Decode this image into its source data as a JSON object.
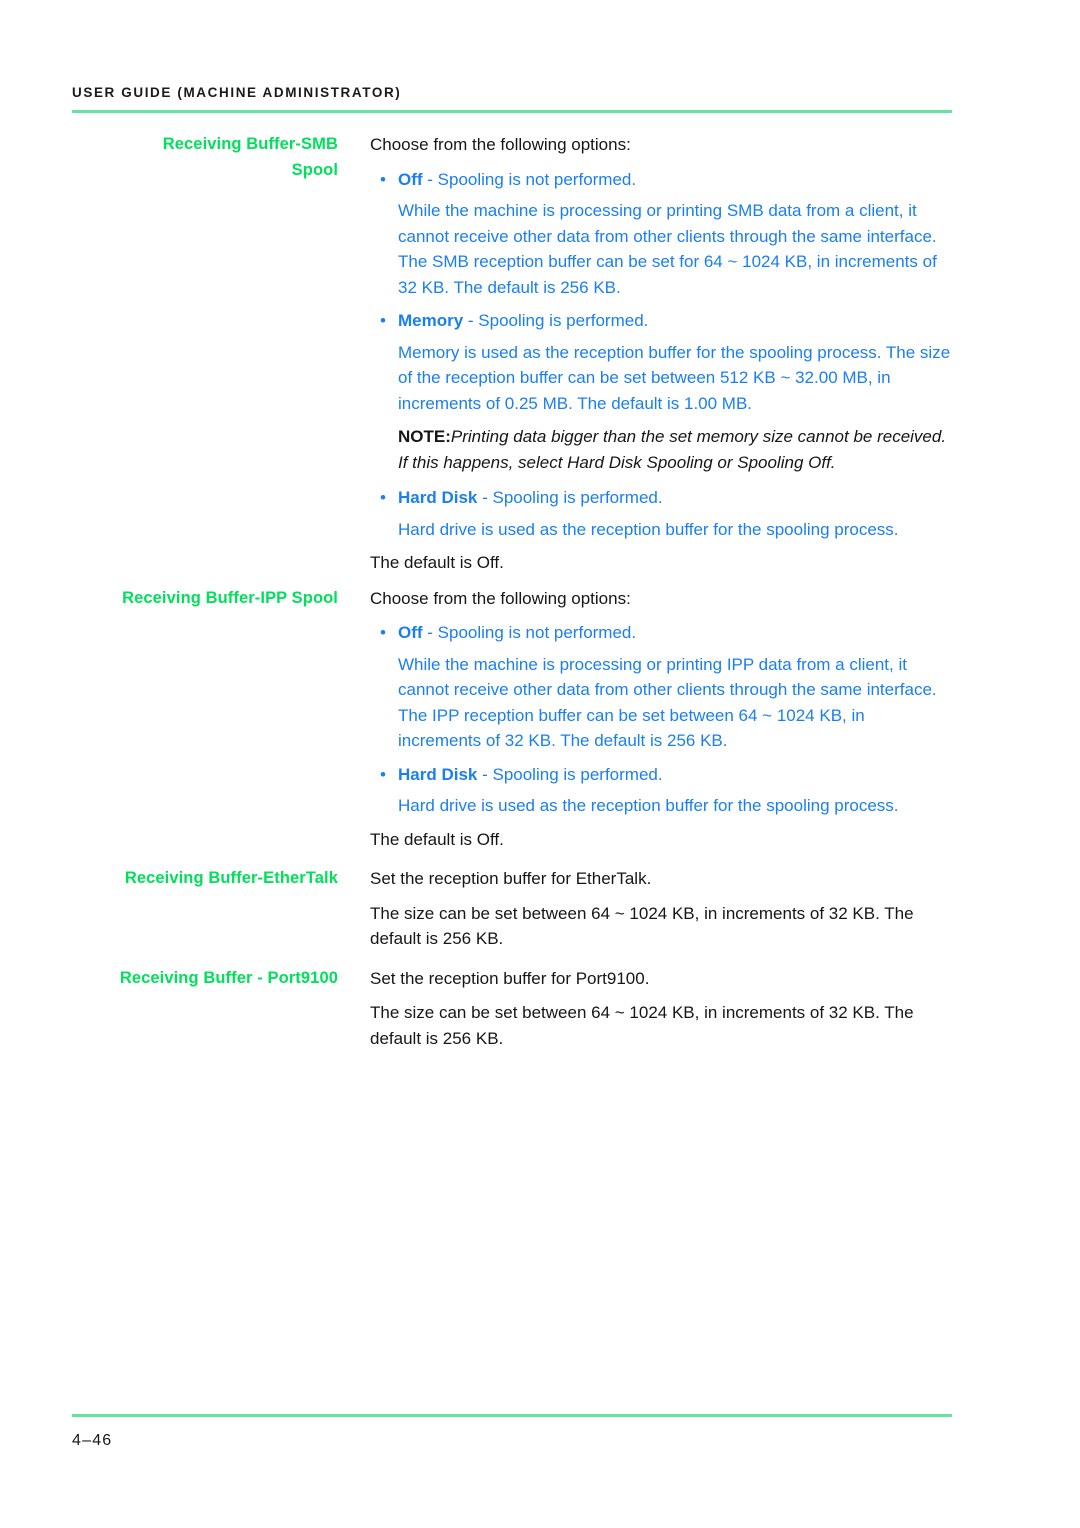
{
  "header": {
    "title": "USER GUIDE (MACHINE ADMINISTRATOR)",
    "rule_color": "#66e3a0"
  },
  "colors": {
    "label_green": "#00e05a",
    "body_blue": "#1a7ff0",
    "body_black": "#161616",
    "rule_green": "#66e3a0"
  },
  "bullet_glyph": "•",
  "sections": [
    {
      "label": "Receiving Buffer-SMB Spool",
      "label_line1": "Receiving Buffer-SMB",
      "label_line2": "Spool",
      "intro": "Choose from the following options:",
      "blocks": [
        {
          "kind": "bullet",
          "term": "Off",
          "separator": " - ",
          "rest": "Spooling is not performed."
        },
        {
          "kind": "indent",
          "text": "While the machine is processing or printing SMB data from a client, it cannot receive other data from other clients through the same interface.  The SMB reception buffer can be set for 64 ~ 1024 KB, in increments of 32 KB. The default is 256 KB."
        },
        {
          "kind": "bullet",
          "term": "Memory",
          "separator": " - ",
          "rest": "Spooling is performed."
        },
        {
          "kind": "indent",
          "text": "Memory is used as the reception buffer for the spooling process.  The size of the reception buffer can be set between 512 KB ~ 32.00 MB, in increments of 0.25 MB. The default is 1.00 MB."
        },
        {
          "kind": "note",
          "lead": "NOTE:",
          "text": "Printing data bigger than the set memory size cannot be received.  If this happens, select Hard Disk Spooling or Spooling Off."
        },
        {
          "kind": "bullet",
          "term": "Hard Disk",
          "separator": " - ",
          "rest": "Spooling is performed."
        },
        {
          "kind": "indent",
          "text": "Hard drive is used as the reception buffer for the spooling process."
        },
        {
          "kind": "plain",
          "text": "The default is Off."
        }
      ]
    },
    {
      "label": "Receiving Buffer-IPP Spool",
      "label_line1": "Receiving Buffer-IPP Spool",
      "label_line2": "",
      "intro": "Choose from the following options:",
      "blocks": [
        {
          "kind": "bullet",
          "term": "Off",
          "separator": " - ",
          "rest": "Spooling is not performed."
        },
        {
          "kind": "indent",
          "text": "While the machine is processing or printing IPP data from a client, it cannot receive other data from other clients through the same interface.  The IPP reception buffer can be set between 64 ~ 1024 KB, in increments of 32 KB. The default is 256 KB."
        },
        {
          "kind": "bullet",
          "term": "Hard Disk",
          "separator": " - ",
          "rest": "Spooling is performed."
        },
        {
          "kind": "indent",
          "text": "Hard drive is used as the reception buffer for the spooling process."
        },
        {
          "kind": "plain",
          "text": "The default is Off."
        }
      ]
    },
    {
      "label": "Receiving Buffer-EtherTalk",
      "label_line1": "Receiving Buffer-EtherTalk",
      "label_line2": "",
      "intro": "Set the reception buffer for EtherTalk.",
      "blocks": [
        {
          "kind": "plain",
          "text": "The size can be set between 64 ~ 1024 KB, in increments of 32 KB. The default is 256 KB."
        }
      ]
    },
    {
      "label": "Receiving Buffer - Port9100",
      "label_line1": "Receiving Buffer - Port9100",
      "label_line2": "",
      "intro": "Set the reception buffer for Port9100.",
      "blocks": [
        {
          "kind": "plain",
          "text": "The size can be set between 64 ~ 1024 KB, in increments of 32 KB. The default is 256 KB."
        }
      ]
    }
  ],
  "footer": {
    "page_number": "4–46"
  }
}
